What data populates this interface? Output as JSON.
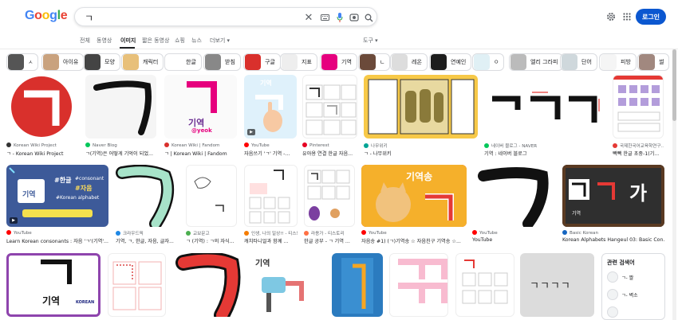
{
  "header": {
    "logo": [
      "G",
      "o",
      "o",
      "g",
      "l",
      "e"
    ],
    "logo_colors": [
      "#4285f4",
      "#ea4335",
      "#fbbc05",
      "#4285f4",
      "#34a853",
      "#ea4335"
    ],
    "query": "ㄱ",
    "login": "로그인"
  },
  "tabs": [
    "전체",
    "동영상",
    "이미지",
    "짧은 동영상",
    "쇼핑",
    "뉴스",
    "더보기 ▾"
  ],
  "tools": "도구 ▾",
  "chips": [
    "ㅅ",
    "아이유",
    "모양",
    "캐릭터",
    "한글",
    "받침",
    "구글",
    "지표",
    "기역",
    "ㄴ",
    "레온",
    "연예인",
    "ㅇ",
    "엘리 그라피",
    "단어",
    "피방",
    "썰"
  ],
  "results": [
    {
      "src": "Korean Wiki Project",
      "title": "ㄱ - Korean Wiki Project"
    },
    {
      "src": "Naver Blog",
      "title": "ㄱ(기역)은 어떻게 기억이 되었..."
    },
    {
      "src": "Korean Wiki | Fandom",
      "title": "ㄱ | Korean Wiki | Fandom"
    },
    {
      "src": "YouTube",
      "title": "자음쓰기 'ㄱ' 기역 -..."
    },
    {
      "src": "Pinterest",
      "title": "유아용 연결 한글 자음..."
    },
    {
      "src": "나무위키",
      "title": "ㄱ - 나무위키"
    },
    {
      "src": "네이버 블로그 - NAVER",
      "title": "기역 : 네이버 블로그"
    },
    {
      "src": "국제한국어교육학연구...",
      "title": "빽빽 한글 초중-1(기..."
    },
    {
      "src": "YouTube",
      "title": "Learn Korean consonants : 자음 'ㄱ'(기역'..."
    },
    {
      "src": "크라우드픽",
      "title": "기역, ㄱ, 한글, 자음, 글자..."
    },
    {
      "src": "교보문고",
      "title": "ㄱ (기역) : ㄱ의 자식..."
    },
    {
      "src": "인생, 나의 일상!! - 티스토리",
      "title": "캐치타니얼과 함께 ..."
    },
    {
      "src": "라용가 - 티스토리",
      "title": "한글 공부 - ㄱ 기역 ..."
    },
    {
      "src": "YouTube",
      "title": "자음송 #1) (ㄱ)기역송 ☆ 자음친구 기역송 ☆..."
    },
    {
      "src": "YouTube",
      "title": "YouTube"
    },
    {
      "src": "Basic Korean",
      "title": "Korean Alphabets Hangeul 03: Basic Con..."
    }
  ],
  "img_text": {
    "giyeok": "기역",
    "giyeok_eng": "@yeok",
    "hashtags": [
      "#한글",
      "#consonant",
      "#자음",
      "#Korean alphabet"
    ],
    "ga": "가",
    "giyeok_song": "기역송",
    "row3_text": "ㄱㄱㄱㄱ",
    "korean_label": "KOREAN",
    "giyeok_small": "기역"
  },
  "related": {
    "title": "관련 검색어",
    "items": [
      "ㄱ- 짤",
      "ㄱ- 벽소"
    ]
  },
  "colors": {
    "accent": "#0b57d0",
    "red": "#d9302c",
    "pink": "#e6007e"
  }
}
